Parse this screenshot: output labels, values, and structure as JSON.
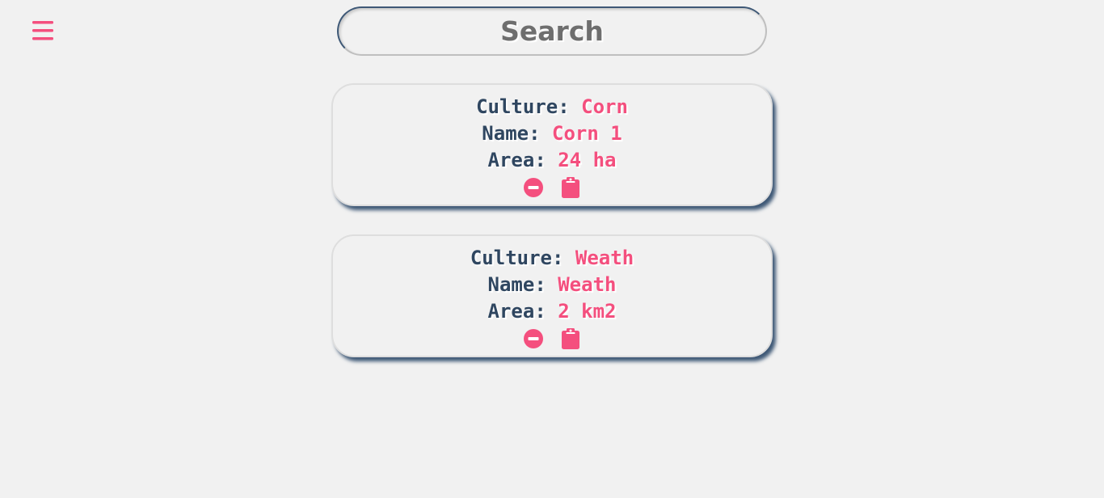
{
  "header": {
    "menu_icon": "hamburger-menu-icon",
    "accent_color": "#f44f7e"
  },
  "search": {
    "placeholder": "Search",
    "value": ""
  },
  "fields": [
    {
      "culture_label": "Culture:",
      "culture": "Corn",
      "name_label": "Name:",
      "name": "Corn 1",
      "area_label": "Area:",
      "area": "24 ha",
      "actions": [
        "minus-circle-icon",
        "clipboard-icon"
      ]
    },
    {
      "culture_label": "Culture:",
      "culture": "Weath",
      "name_label": "Name:",
      "name": "Weath",
      "area_label": "Area:",
      "area": "2 km2",
      "actions": [
        "minus-circle-icon",
        "clipboard-icon"
      ]
    }
  ],
  "colors": {
    "background": "#f1f1f1",
    "label": "#2f4660",
    "value": "#f44f7e",
    "shadow": "#3e5876"
  }
}
